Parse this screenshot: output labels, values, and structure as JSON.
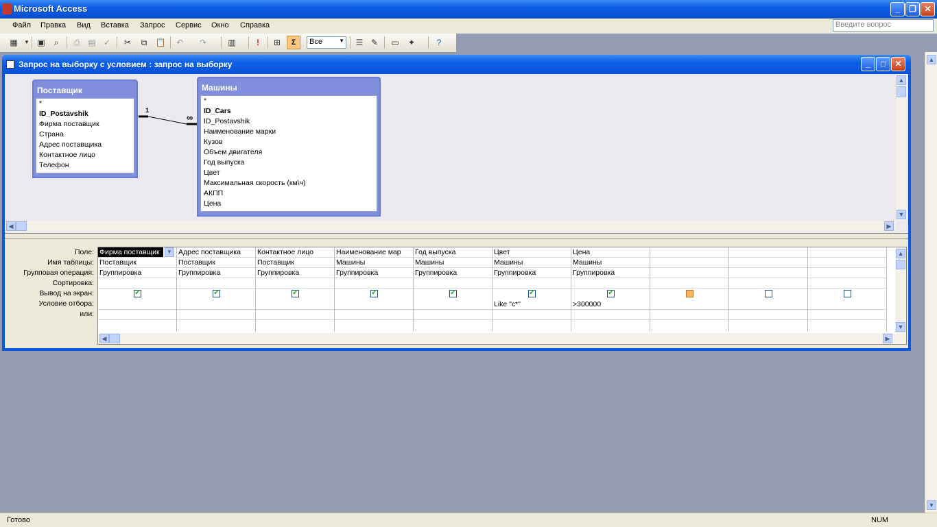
{
  "app": {
    "title": "Microsoft Access"
  },
  "menu": [
    "Файл",
    "Правка",
    "Вид",
    "Вставка",
    "Запрос",
    "Сервис",
    "Окно",
    "Справка"
  ],
  "help": {
    "placeholder": "Введите вопрос"
  },
  "toolbar": {
    "combo_value": "Все",
    "sigma": "Σ"
  },
  "query_window": {
    "title": "Запрос на выборку с условием : запрос на выборку"
  },
  "tables": [
    {
      "name": "Поставщик",
      "fields": [
        "*",
        "ID_Postavshik",
        "Фирма поставщик",
        "Страна",
        "Адрес поставщика",
        "Контактное лицо",
        "Телефон"
      ]
    },
    {
      "name": "Машины",
      "fields": [
        "*",
        "ID_Cars",
        "ID_Postavshik",
        "Наименование марки",
        "Кузов",
        "Объем двигателя",
        "Год выпуска",
        "Цвет",
        "Максимальная скорость (км\\ч)",
        "АКПП",
        "Цена"
      ]
    }
  ],
  "relation": {
    "one": "1",
    "many": "∞"
  },
  "grid": {
    "row_labels": [
      "Поле:",
      "Имя таблицы:",
      "Групповая операция:",
      "Сортировка:",
      "Вывод на экран:",
      "Условие отбора:",
      "или:"
    ],
    "fields": [
      "Фирма поставщик",
      "Адрес поставщика",
      "Контактное лицо",
      "Наименование мар",
      "Год выпуска",
      "Цвет",
      "Цена",
      "",
      "",
      ""
    ],
    "tables": [
      "Поставщик",
      "Поставщик",
      "Поставщик",
      "Машины",
      "Машины",
      "Машины",
      "Машины",
      "",
      "",
      ""
    ],
    "groupby": [
      "Группировка",
      "Группировка",
      "Группировка",
      "Группировка",
      "Группировка",
      "Группировка",
      "Группировка",
      "",
      "",
      ""
    ],
    "show": [
      true,
      true,
      true,
      true,
      true,
      true,
      true,
      false,
      false,
      false
    ],
    "criteria": [
      "",
      "",
      "",
      "",
      "",
      "Like \"c*\"",
      ">300000",
      "",
      "",
      ""
    ]
  },
  "status": {
    "text": "Готово",
    "num": "NUM"
  }
}
